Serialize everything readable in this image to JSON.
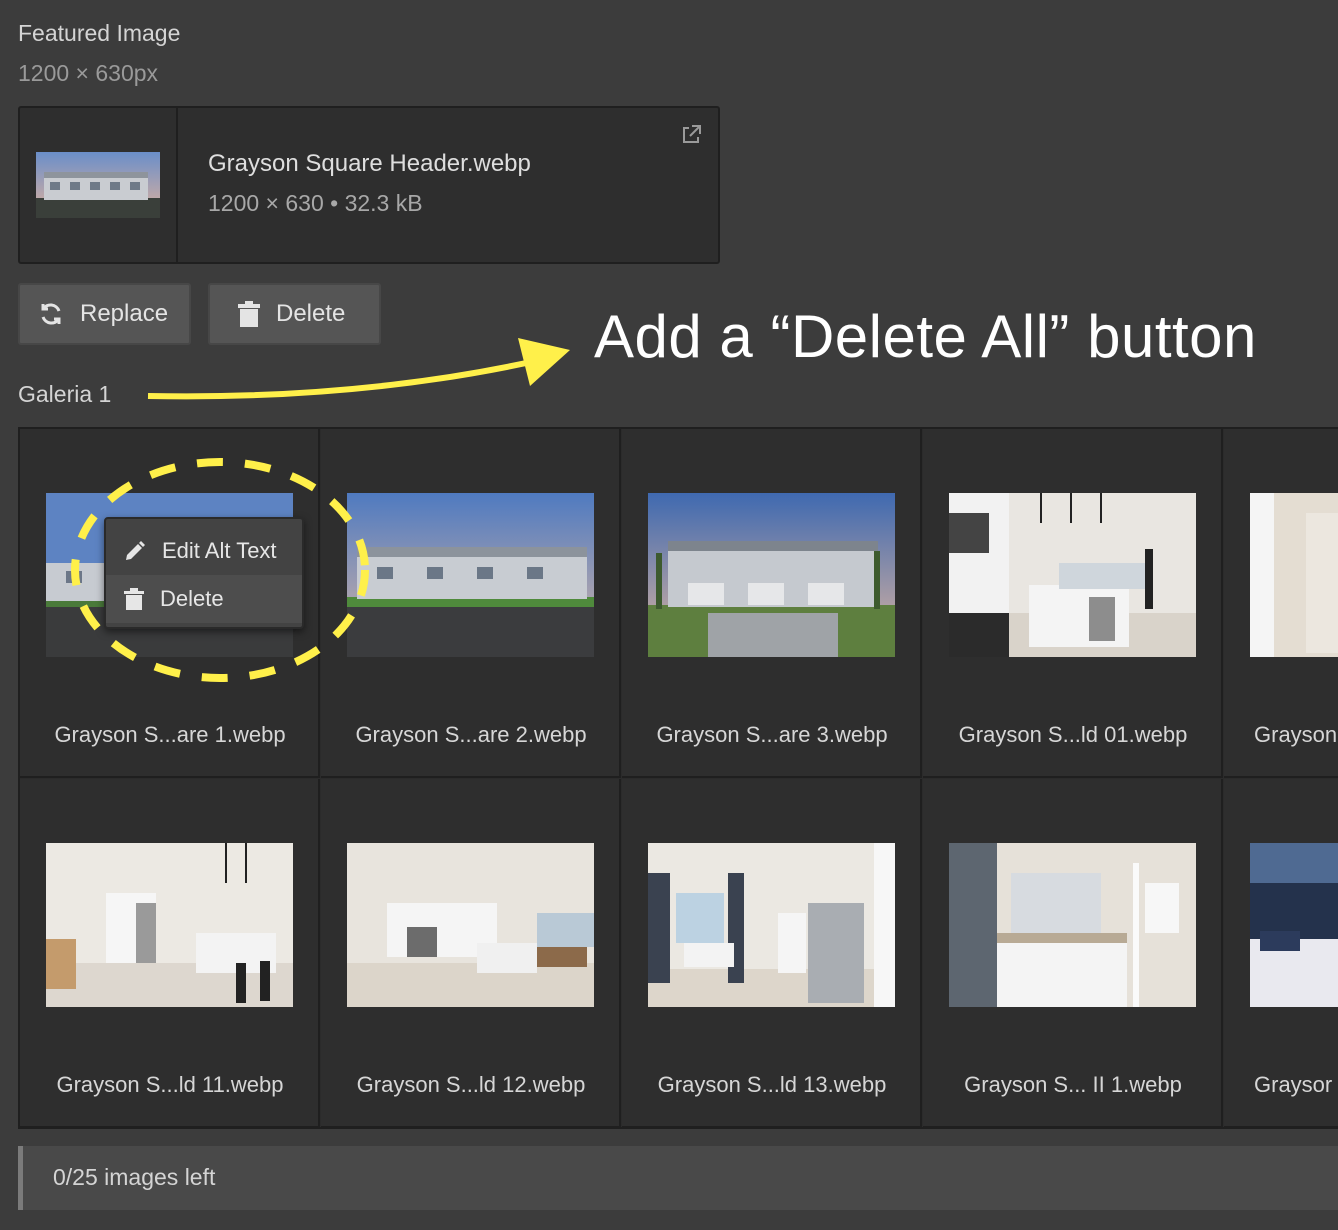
{
  "featured": {
    "section_title": "Featured Image",
    "dimensions": "1200 × 630px",
    "file_name": "Grayson Square Header.webp",
    "file_meta": "1200 × 630 • 32.3 kB",
    "icons": {
      "external": "external-link-icon"
    }
  },
  "actions": {
    "replace_label": "Replace",
    "delete_label": "Delete",
    "icons": {
      "replace": "refresh-icon",
      "delete": "trash-icon"
    }
  },
  "annotation": {
    "text": "Add a “Delete All” button",
    "color": "#fff04a"
  },
  "gallery": {
    "title": "Galeria 1",
    "items": [
      {
        "caption": "Grayson S...are 1.webp"
      },
      {
        "caption": "Grayson S...are 2.webp"
      },
      {
        "caption": "Grayson S...are 3.webp"
      },
      {
        "caption": "Grayson S...ld 01.webp"
      },
      {
        "caption": "Grayson"
      },
      {
        "caption": "Grayson S...ld 11.webp"
      },
      {
        "caption": "Grayson S...ld 12.webp"
      },
      {
        "caption": "Grayson S...ld 13.webp"
      },
      {
        "caption": "Grayson S... II 1.webp"
      },
      {
        "caption": "Graysor"
      }
    ]
  },
  "context_menu": {
    "edit_alt_label": "Edit Alt Text",
    "delete_label": "Delete",
    "icons": {
      "edit": "pencil-icon",
      "delete": "trash-icon"
    }
  },
  "footer": {
    "status": "0/25 images left"
  },
  "colors": {
    "background": "#3c3c3c",
    "panel": "#2e2e2e",
    "highlight": "#fff04a"
  }
}
